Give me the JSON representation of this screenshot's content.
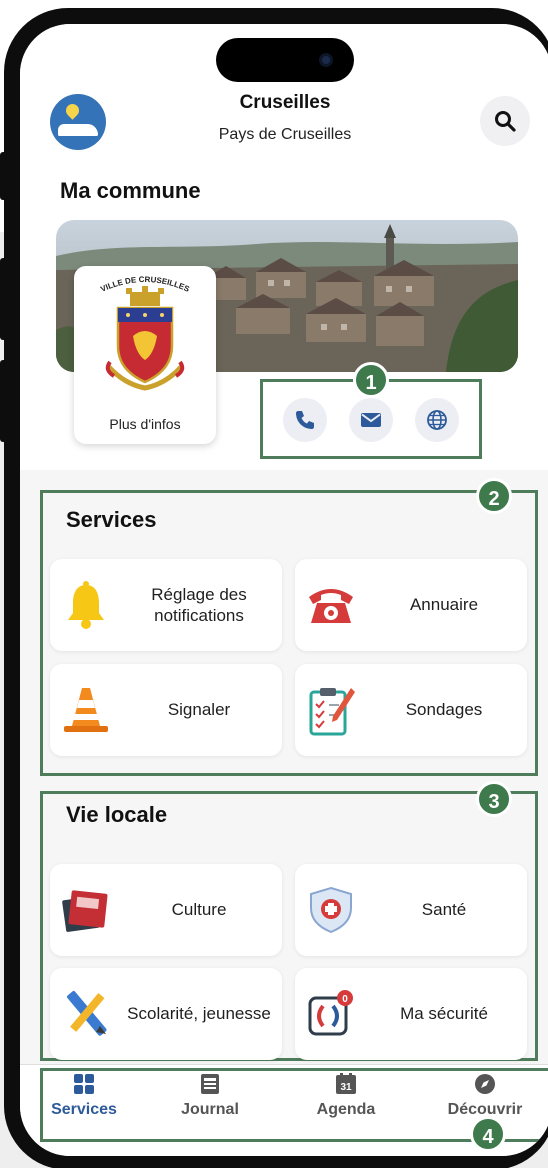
{
  "app": {
    "title": "Cruseilles",
    "subtitle": "Pays de Cruseilles"
  },
  "commune": {
    "heading": "Ma commune",
    "crest_text": "VILLE DE CRUSEILLES",
    "more_info_label": "Plus d'infos"
  },
  "icons": {
    "search": "search-icon",
    "phone": "phone-icon",
    "mail": "mail-icon",
    "web": "globe-icon"
  },
  "badges": [
    "1",
    "2",
    "3",
    "4"
  ],
  "services": {
    "title": "Services",
    "items": [
      {
        "label": "Réglage des notifications",
        "icon": "bell-icon"
      },
      {
        "label": "Annuaire",
        "icon": "telephone-icon"
      },
      {
        "label": "Signaler",
        "icon": "traffic-cone-icon"
      },
      {
        "label": "Sondages",
        "icon": "clipboard-icon"
      }
    ]
  },
  "vie_locale": {
    "title": "Vie locale",
    "items": [
      {
        "label": "Culture",
        "icon": "books-icon"
      },
      {
        "label": "Santé",
        "icon": "health-shield-icon"
      },
      {
        "label": "Scolarité, jeunesse",
        "icon": "pencil-ruler-icon"
      },
      {
        "label": "Ma sécurité",
        "icon": "security-phone-icon",
        "badge": "0"
      }
    ]
  },
  "tabs": [
    {
      "label": "Services",
      "icon": "grid-icon",
      "active": true
    },
    {
      "label": "Journal",
      "icon": "newspaper-icon",
      "active": false
    },
    {
      "label": "Agenda",
      "icon": "calendar-icon",
      "date": "31",
      "active": false
    },
    {
      "label": "Découvrir",
      "icon": "compass-icon",
      "active": false
    }
  ],
  "colors": {
    "accent": "#2d5a9a",
    "annotation": "#4f7d5b",
    "badge": "#3f7a4d"
  }
}
